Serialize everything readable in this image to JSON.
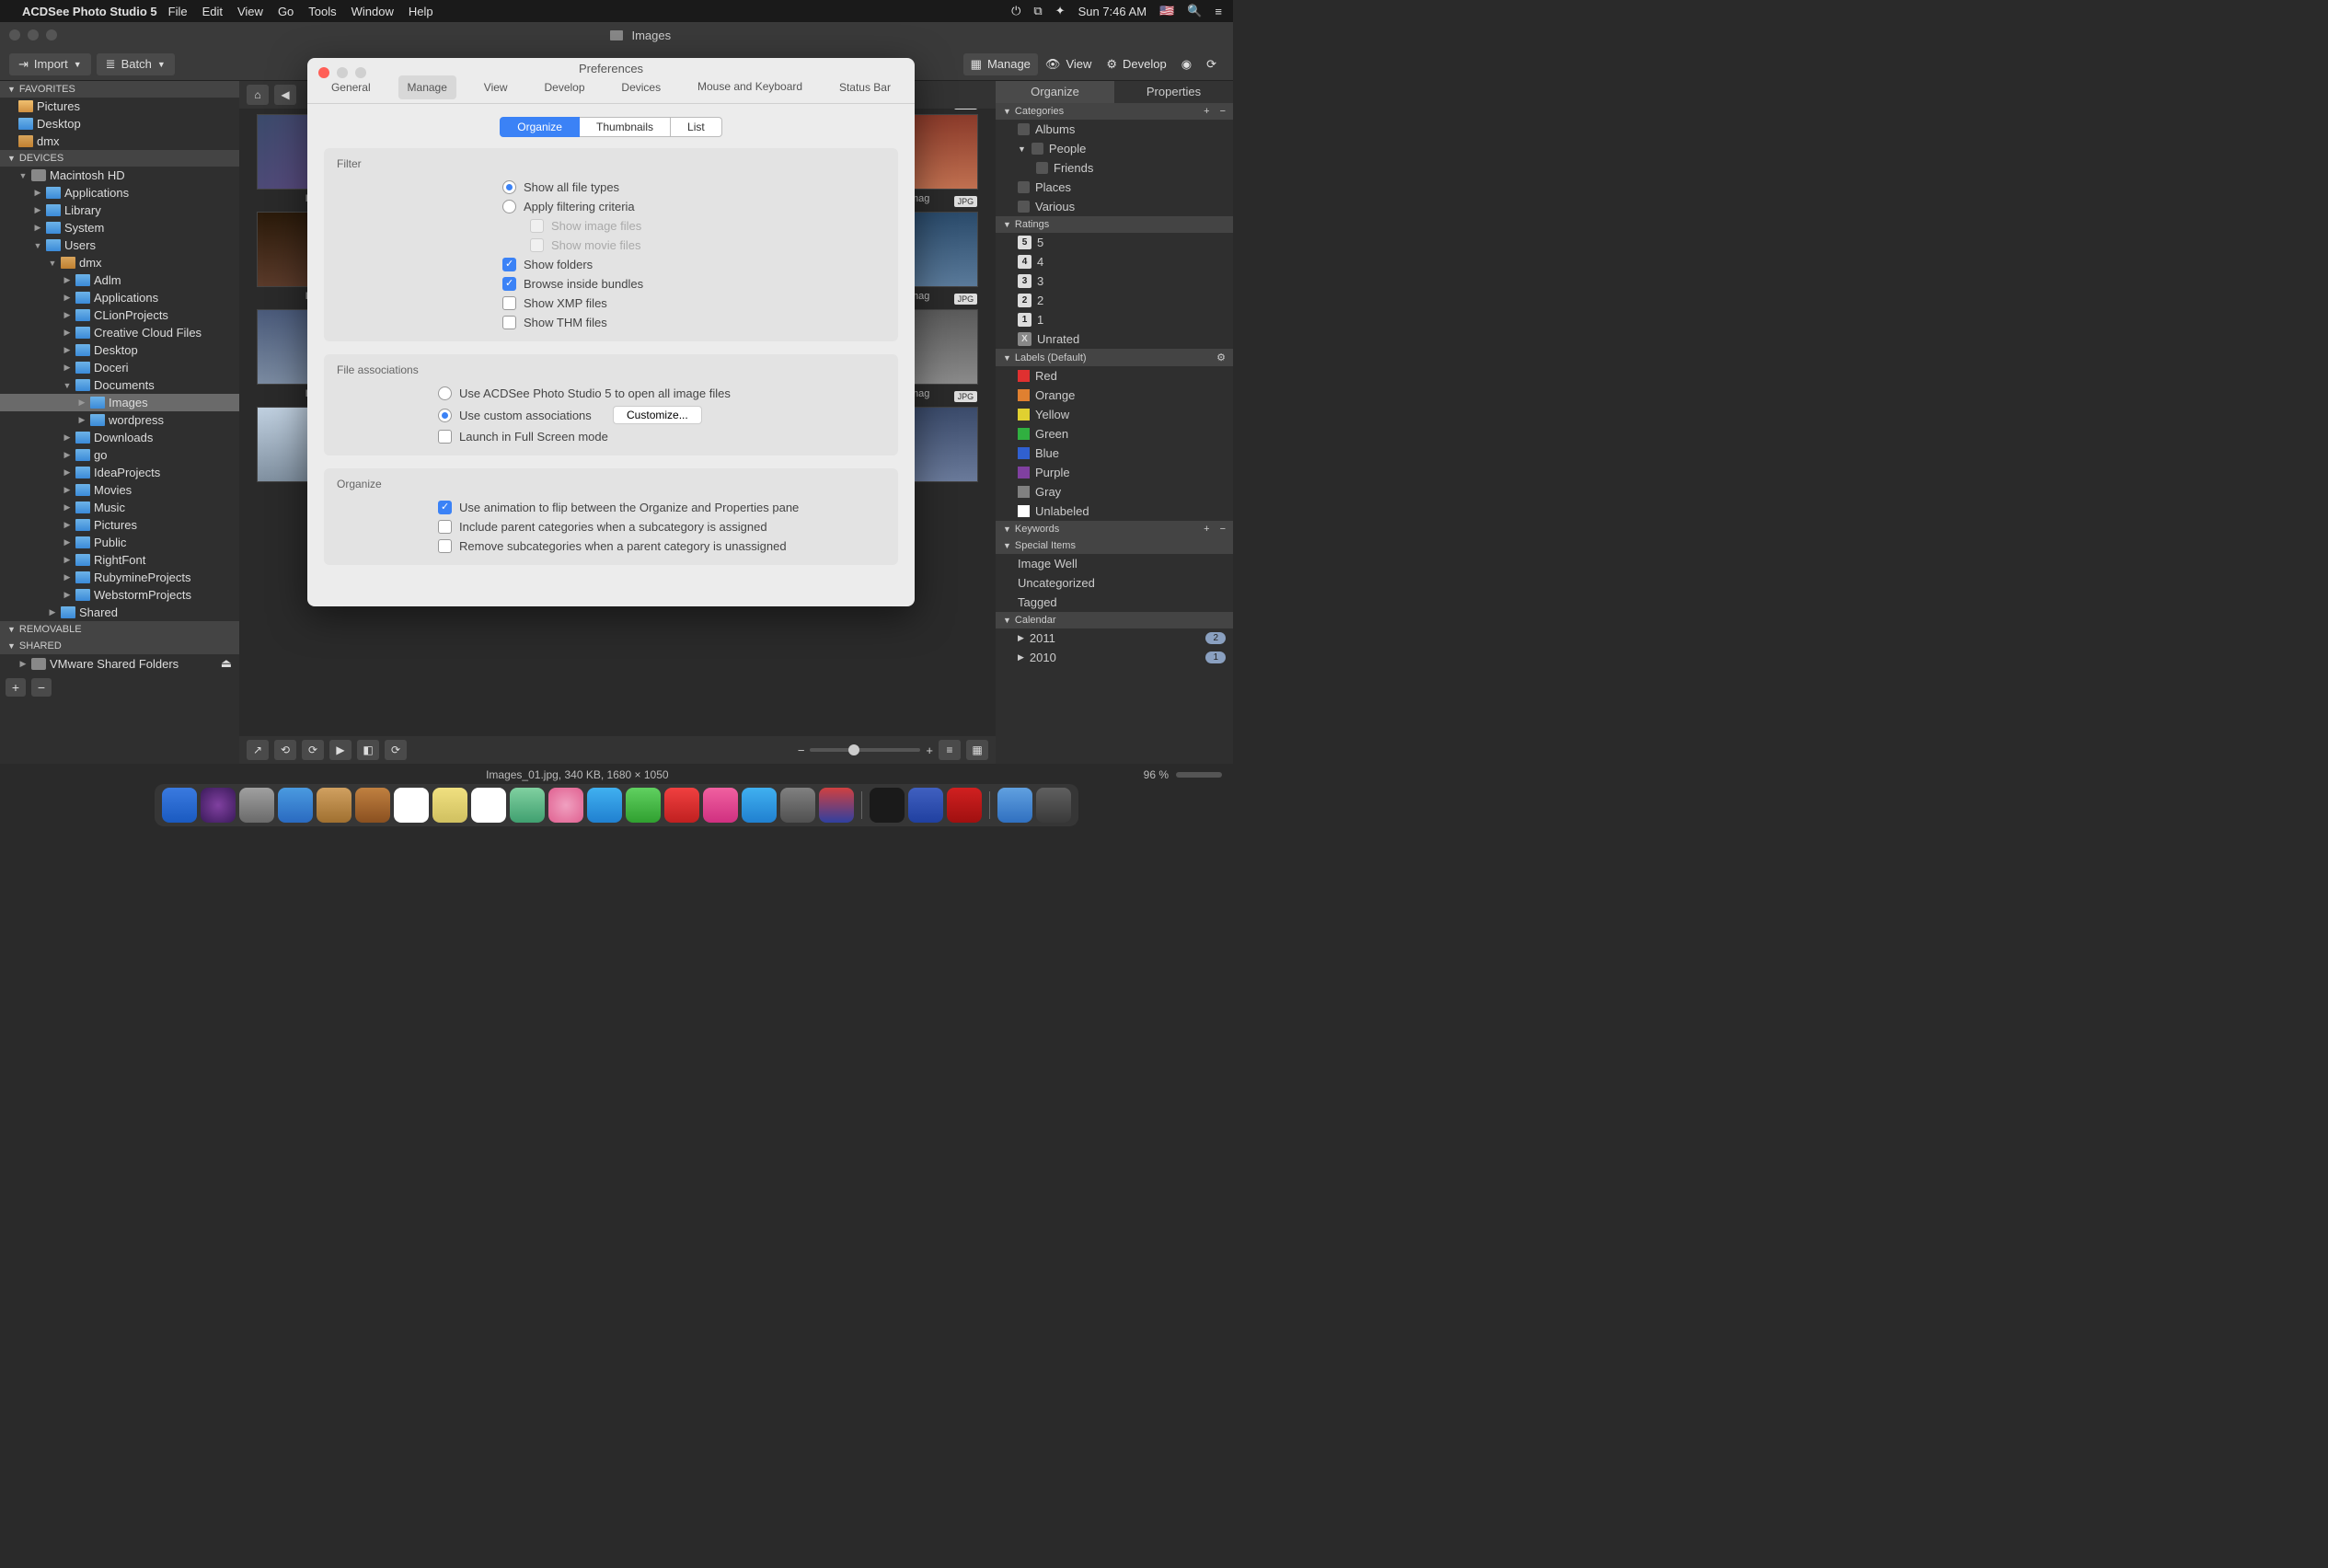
{
  "menubar": {
    "app": "ACDSee Photo Studio 5",
    "items": [
      "File",
      "Edit",
      "View",
      "Go",
      "Tools",
      "Window",
      "Help"
    ],
    "clock": "Sun 7:46 AM"
  },
  "titlebar": {
    "title": "Images"
  },
  "toolbar": {
    "import": "Import",
    "batch": "Batch",
    "modes": {
      "manage": "Manage",
      "view": "View",
      "develop": "Develop"
    }
  },
  "left": {
    "sections": {
      "favorites": "FAVORITES",
      "devices": "DEVICES",
      "removable": "REMOVABLE",
      "shared": "SHARED"
    },
    "favorites": [
      "Pictures",
      "Desktop",
      "dmx"
    ],
    "devices_root": "Macintosh HD",
    "mac_children": [
      "Applications",
      "Library",
      "System",
      "Users"
    ],
    "user": "dmx",
    "user_children": [
      "Adlm",
      "Applications",
      "CLionProjects",
      "Creative Cloud Files",
      "Desktop",
      "Doceri",
      "Documents"
    ],
    "documents_children": [
      "Images",
      "wordpress"
    ],
    "user_children_after": [
      "Downloads",
      "go",
      "IdeaProjects",
      "Movies",
      "Music",
      "Pictures",
      "Public",
      "RightFont",
      "RubymineProjects",
      "WebstormProjects"
    ],
    "mac_after": "Shared",
    "shared_items": [
      "VMware Shared Folders"
    ]
  },
  "right": {
    "tabs": {
      "organize": "Organize",
      "properties": "Properties"
    },
    "categories": {
      "header": "Categories",
      "items": [
        "Albums",
        "People",
        "Places",
        "Various"
      ],
      "people_sub": "Friends"
    },
    "ratings": {
      "header": "Ratings",
      "items": [
        "5",
        "4",
        "3",
        "2",
        "1",
        "Unrated"
      ]
    },
    "labels": {
      "header": "Labels (Default)",
      "items": [
        {
          "name": "Red",
          "c": "#e03030"
        },
        {
          "name": "Orange",
          "c": "#e08030"
        },
        {
          "name": "Yellow",
          "c": "#e0d030"
        },
        {
          "name": "Green",
          "c": "#30b040"
        },
        {
          "name": "Blue",
          "c": "#3060d0"
        },
        {
          "name": "Purple",
          "c": "#8040a0"
        },
        {
          "name": "Gray",
          "c": "#808080"
        },
        {
          "name": "Unlabeled",
          "c": "#ffffff"
        }
      ]
    },
    "keywords": "Keywords",
    "special": {
      "header": "Special Items",
      "items": [
        "Image Well",
        "Uncategorized",
        "Tagged"
      ]
    },
    "calendar": {
      "header": "Calendar",
      "items": [
        {
          "y": "2011",
          "n": "2"
        },
        {
          "y": "2010",
          "n": "1"
        }
      ]
    }
  },
  "status": {
    "file": "Images_01.jpg, 340 KB, 1680 × 1050",
    "zoom": "96 %"
  },
  "thumb_badge": "JPG",
  "thumb_prefix": "Imag",
  "modal": {
    "title": "Preferences",
    "tabs": [
      "General",
      "Manage",
      "View",
      "Develop",
      "Devices",
      "Mouse and Keyboard",
      "Status Bar"
    ],
    "active_tab": "Manage",
    "seg": [
      "Organize",
      "Thumbnails",
      "List"
    ],
    "filter": {
      "title": "Filter",
      "opt_all": "Show all file types",
      "opt_criteria": "Apply filtering criteria",
      "sub_img": "Show image files",
      "sub_mov": "Show movie files",
      "folders": "Show folders",
      "bundles": "Browse inside bundles",
      "xmp": "Show XMP files",
      "thm": "Show THM files"
    },
    "assoc": {
      "title": "File associations",
      "opt_acdsee": "Use ACDSee Photo Studio 5 to open all image files",
      "opt_custom": "Use custom associations",
      "customize": "Customize...",
      "fullscreen": "Launch in Full Screen mode"
    },
    "organize": {
      "title": "Organize",
      "anim": "Use animation to flip between the Organize and Properties pane",
      "parent": "Include parent categories when a subcategory is assigned",
      "remove": "Remove subcategories when a parent category is unassigned"
    }
  }
}
